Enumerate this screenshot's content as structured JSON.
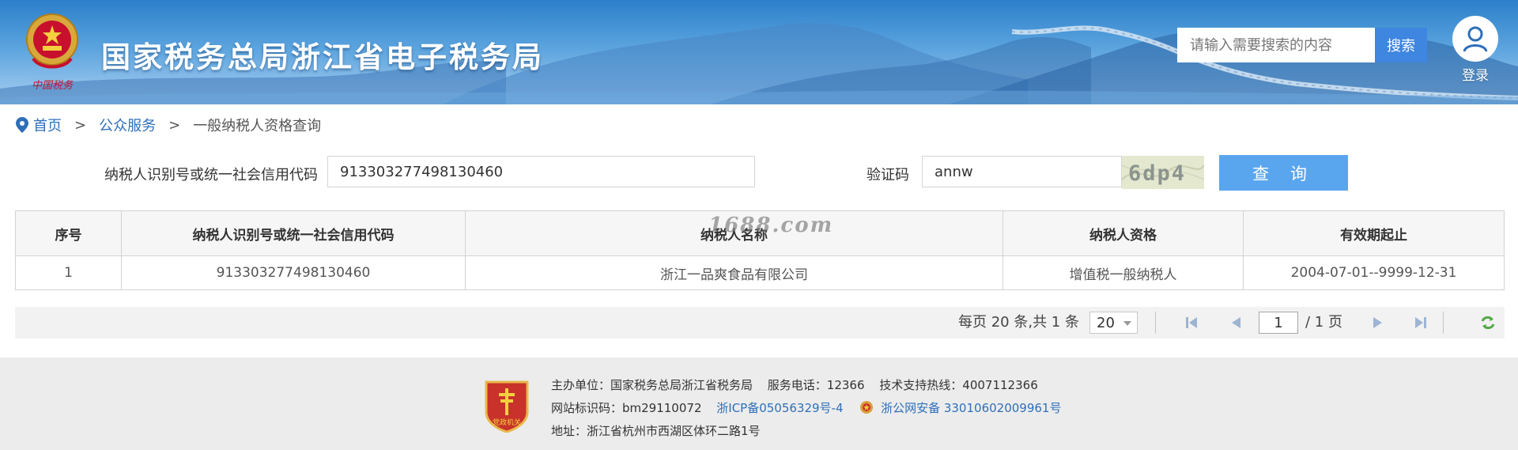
{
  "header": {
    "site_title": "国家税务总局浙江省电子税务局",
    "emblem_caption": "中国税务",
    "search_placeholder": "请输入需要搜索的内容",
    "search_button": "搜索",
    "login_label": "登录"
  },
  "breadcrumb": {
    "items": [
      "首页",
      "公众服务",
      "一般纳税人资格查询"
    ],
    "separator": ">"
  },
  "query_form": {
    "taxpayer_id_label": "纳税人识别号或统一社会信用代码",
    "taxpayer_id_value": "913303277498130460",
    "captcha_label": "验证码",
    "captcha_value": "annw",
    "captcha_image_text": "6dp4",
    "query_button": "查 询"
  },
  "results_table": {
    "headers": [
      "序号",
      "纳税人识别号或统一社会信用代码",
      "纳税人名称",
      "纳税人资格",
      "有效期起止"
    ],
    "rows": [
      [
        "1",
        "913303277498130460",
        "浙江一品爽食品有限公司",
        "增值税一般纳税人",
        "2004-07-01--9999-12-31"
      ]
    ]
  },
  "watermark": "1688.com",
  "pager": {
    "summary": "每页 20 条,共 1 条",
    "page_size": "20",
    "current_page": "1",
    "total_pages": "/ 1 页"
  },
  "footer": {
    "host": "主办单位：国家税务总局浙江省税务局",
    "phone": "服务电话：12366",
    "support": "技术支持热线：4007112366",
    "site_id": "网站标识码：bm29110072",
    "icp": "浙ICP备05056329号-4",
    "police_record": "浙公网安备 33010602009961号",
    "address": "地址：浙江省杭州市西湖区体环二路1号",
    "logo_text": "党政机关"
  },
  "colors": {
    "header_blue": "#2b7fc9",
    "search_button": "#3f86e0",
    "query_button": "#5aa6ee",
    "link_blue": "#2e6fb8",
    "footer_bg": "#ececec"
  }
}
